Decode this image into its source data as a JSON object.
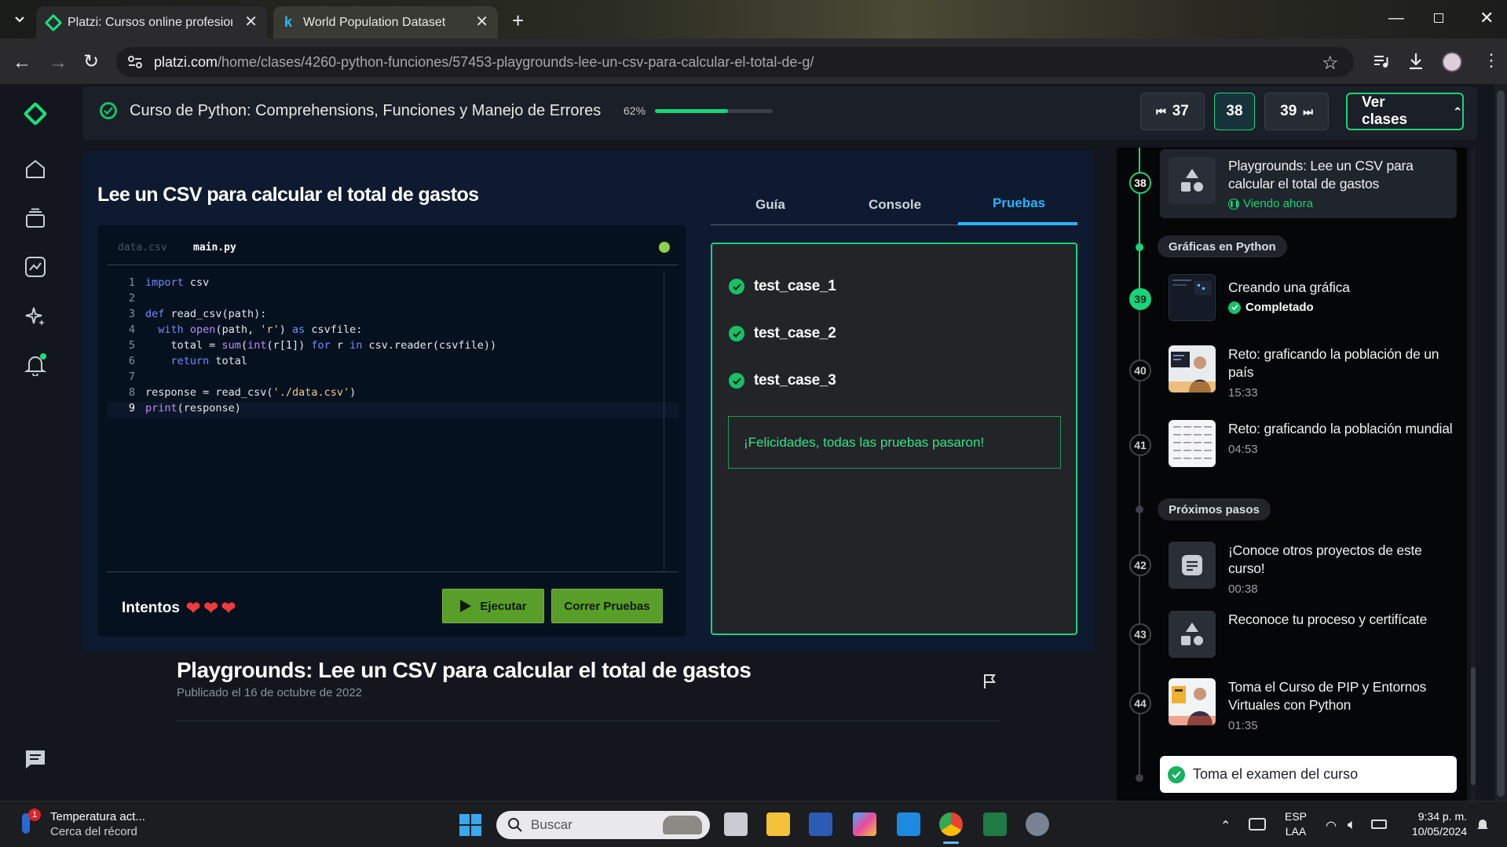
{
  "browser": {
    "tabs": [
      {
        "title": "Platzi: Cursos online profesiona",
        "favicon": "platzi-logo"
      },
      {
        "title": "World Population Dataset",
        "favicon": "kaggle-logo"
      }
    ],
    "url_host": "platzi.com",
    "url_path": "/home/clases/4260-python-funciones/57453-playgrounds-lee-un-csv-para-calcular-el-total-de-g/"
  },
  "course": {
    "title": "Curso de Python: Comprehensions, Funciones y Manejo de Errores",
    "progress_label": "62%",
    "progress": 0.62,
    "prev_label": "37",
    "current_label": "38",
    "next_label": "39",
    "ver_clases_label": "Ver clases"
  },
  "playground": {
    "title": "Lee un CSV para calcular el total de gastos",
    "file_tabs": [
      "data.csv",
      "main.py"
    ],
    "active_file": "main.py",
    "code_lines": [
      {
        "n": "1",
        "text": "import csv"
      },
      {
        "n": "2",
        "text": ""
      },
      {
        "n": "3",
        "text": "def read_csv(path):"
      },
      {
        "n": "4",
        "text": "  with open(path, 'r') as csvfile:"
      },
      {
        "n": "5",
        "text": "    total = sum(int(r[1]) for r in csv.reader(csvfile))"
      },
      {
        "n": "6",
        "text": "    return total"
      },
      {
        "n": "7",
        "text": ""
      },
      {
        "n": "8",
        "text": "response = read_csv('./data.csv')"
      },
      {
        "n": "9",
        "text": "print(response)"
      }
    ],
    "attempts_label": "Intentos",
    "hearts": 3,
    "run_label": "Ejecutar",
    "tests_label": "Correr Pruebas",
    "panel_tabs": [
      "Guía",
      "Console",
      "Pruebas"
    ],
    "active_panel_tab": "Pruebas",
    "tests": [
      "test_case_1",
      "test_case_2",
      "test_case_3"
    ],
    "success_message": "¡Felicidades, todas las pruebas pasaron!"
  },
  "lesson": {
    "title": "Playgrounds: Lee un CSV para calcular el total de gastos",
    "published": "Publicado el 16 de octubre de 2022"
  },
  "sidebar": {
    "current": {
      "num": "38",
      "title": "Playgrounds: Lee un CSV para calcular el total de gastos",
      "status": "Viendo ahora"
    },
    "section1": "Gráficas en Python",
    "item39": {
      "num": "39",
      "title": "Creando una gráfica",
      "status": "Completado"
    },
    "item40": {
      "num": "40",
      "title": "Reto: graficando la población de un país",
      "duration": "15:33"
    },
    "item41": {
      "num": "41",
      "title": "Reto: graficando la población mundial",
      "duration": "04:53"
    },
    "section2": "Próximos pasos",
    "item42": {
      "num": "42",
      "title": "¡Conoce otros proyectos de este curso!",
      "duration": "00:38"
    },
    "item43": {
      "num": "43",
      "title": "Reconoce tu proceso y certifícate"
    },
    "item44": {
      "num": "44",
      "title": "Toma el Curso de PIP y Entornos Virtuales con Python",
      "duration": "01:35"
    },
    "exam_label": "Toma el examen del curso"
  },
  "taskbar": {
    "weather_title": "Temperatura act...",
    "weather_sub": "Cerca del récord",
    "weather_badge": "1",
    "search_placeholder": "Buscar",
    "lang1": "ESP",
    "lang2": "LAA",
    "time": "9:34 p. m.",
    "date": "10/05/2024"
  },
  "colors": {
    "accent": "#18d47a",
    "run_button": "#5a9e2a",
    "panel": "#0d1a30"
  }
}
